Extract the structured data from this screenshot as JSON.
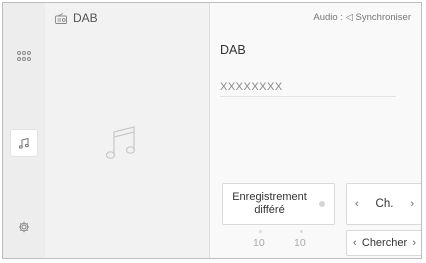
{
  "source": {
    "label": "DAB",
    "icon": "radio-icon"
  },
  "header": {
    "audio_status": "Audio : ◁ Synchroniser"
  },
  "station": {
    "title": "DAB",
    "name": "XXXXXXXX"
  },
  "controls": {
    "recording_label_line1": "Enregistrement",
    "recording_label_line2": "différé",
    "channel_label": "Ch.",
    "search_label": "Chercher",
    "prev_symbol": "‹",
    "next_symbol": "›",
    "time_left": "10",
    "time_right": "10"
  },
  "sidebar": {
    "items": [
      {
        "name": "apps",
        "icon": "grid-icon"
      },
      {
        "name": "media",
        "icon": "music-note-icon",
        "active": true
      },
      {
        "name": "settings",
        "icon": "gear-icon"
      }
    ]
  }
}
